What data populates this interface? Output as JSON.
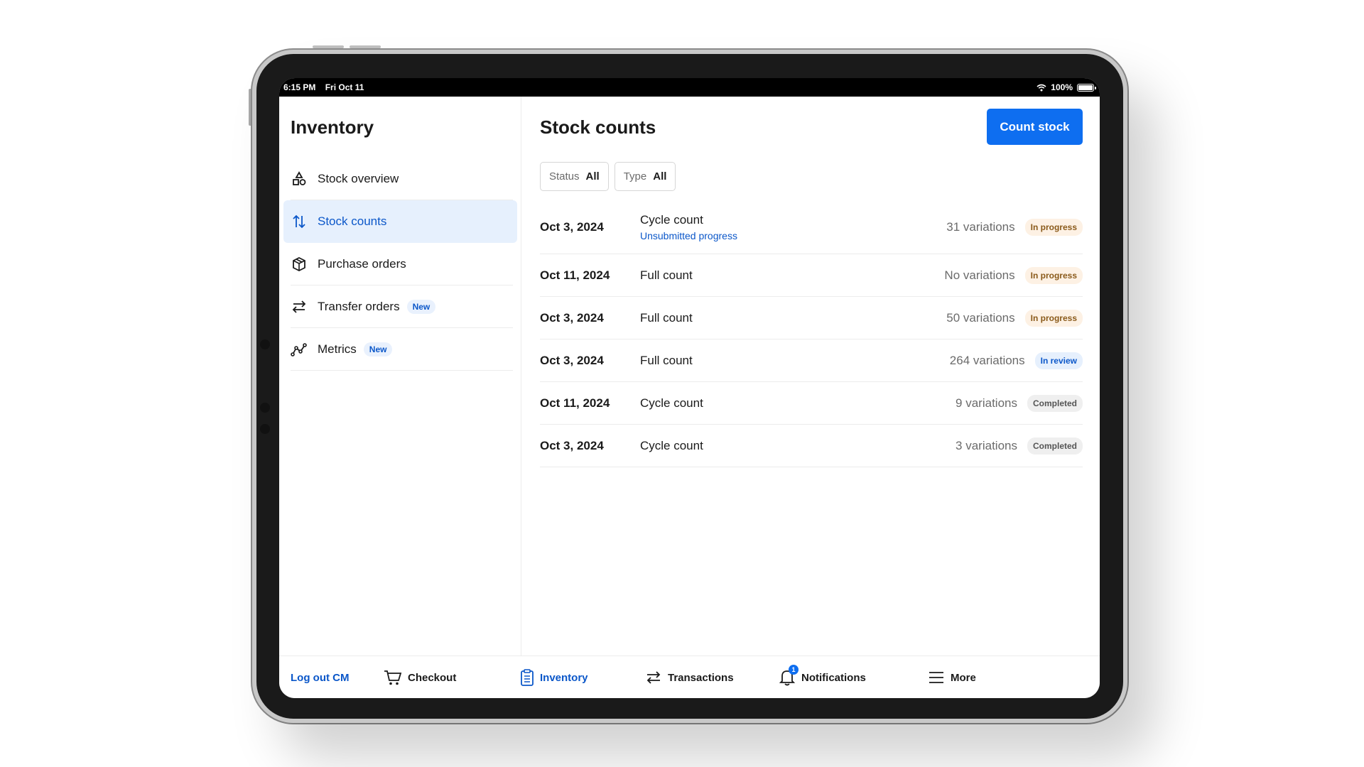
{
  "status_bar": {
    "time": "6:15 PM",
    "date": "Fri Oct 11",
    "battery": "100%"
  },
  "sidebar": {
    "title": "Inventory",
    "items": [
      {
        "label": "Stock overview",
        "icon": "shapes-icon"
      },
      {
        "label": "Stock counts",
        "icon": "sort-arrows-icon",
        "active": true
      },
      {
        "label": "Purchase orders",
        "icon": "box-icon"
      },
      {
        "label": "Transfer orders",
        "icon": "swap-arrows-icon",
        "badge": "New"
      },
      {
        "label": "Metrics",
        "icon": "line-chart-icon",
        "badge": "New"
      }
    ]
  },
  "main": {
    "title": "Stock counts",
    "count_button": "Count stock",
    "filters": [
      {
        "label": "Status",
        "value": "All"
      },
      {
        "label": "Type",
        "value": "All"
      }
    ],
    "rows": [
      {
        "date": "Oct 3, 2024",
        "type": "Cycle count",
        "sub": "Unsubmitted progress",
        "variations": "31 variations",
        "status": "In progress"
      },
      {
        "date": "Oct 11, 2024",
        "type": "Full count",
        "variations": "No variations",
        "status": "In progress"
      },
      {
        "date": "Oct 3, 2024",
        "type": "Full count",
        "variations": "50 variations",
        "status": "In progress"
      },
      {
        "date": "Oct 3, 2024",
        "type": "Full count",
        "variations": "264 variations",
        "status": "In review"
      },
      {
        "date": "Oct 11, 2024",
        "type": "Cycle count",
        "variations": "9 variations",
        "status": "Completed"
      },
      {
        "date": "Oct 3, 2024",
        "type": "Cycle count",
        "variations": "3 variations",
        "status": "Completed"
      }
    ]
  },
  "tabbar": {
    "logout": "Log out CM",
    "tabs": [
      {
        "label": "Checkout",
        "icon": "cart-icon"
      },
      {
        "label": "Inventory",
        "icon": "clipboard-icon",
        "active": true
      },
      {
        "label": "Transactions",
        "icon": "swap-arrows-icon"
      },
      {
        "label": "Notifications",
        "icon": "bell-icon",
        "badge": "1"
      },
      {
        "label": "More",
        "icon": "menu-icon"
      }
    ]
  },
  "colors": {
    "accent": "#0e6ef0",
    "active_bg": "#e6f0fd",
    "link": "#0b57c9"
  }
}
